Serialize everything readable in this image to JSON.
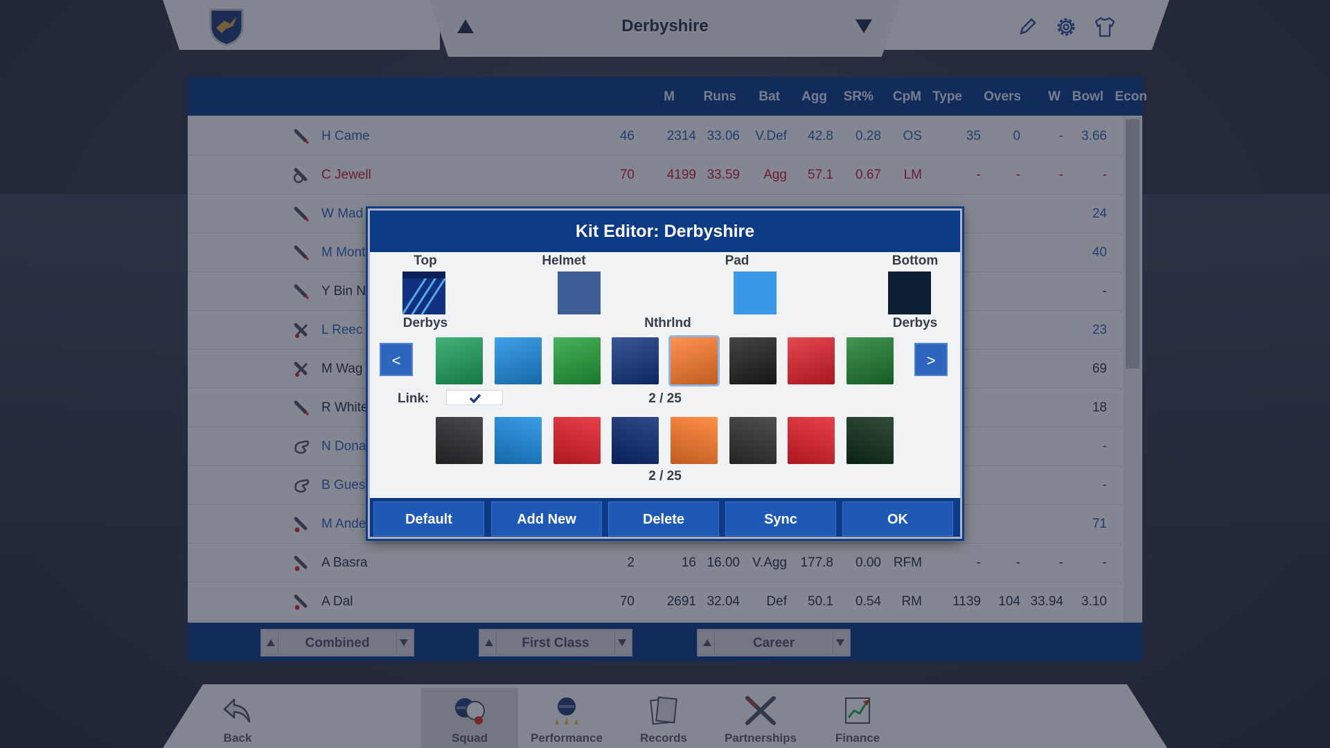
{
  "header": {
    "team": "Derbyshire"
  },
  "table": {
    "columns": [
      "M",
      "Runs",
      "Bat",
      "Agg",
      "SR%",
      "CpM",
      "Type",
      "Overs",
      "W",
      "Bowl",
      "Econ"
    ],
    "rows": [
      {
        "name": "H Came",
        "role": "batter",
        "color": "#2f5fb0",
        "cells": [
          "46",
          "2314",
          "33.06",
          "V.Def",
          "42.8",
          "0.28",
          "OS",
          "35",
          "0",
          "-",
          "3.66"
        ]
      },
      {
        "name": "C Jewell",
        "role": "keeper",
        "color": "#b4213a",
        "cells": [
          "70",
          "4199",
          "33.59",
          "Agg",
          "57.1",
          "0.67",
          "LM",
          "-",
          "-",
          "-",
          "-"
        ]
      },
      {
        "name": "W Mad",
        "role": "batter",
        "color": "#2f5fb0",
        "cells": [
          "",
          "",
          "",
          "",
          "",
          "",
          "",
          "",
          "",
          "",
          "24"
        ]
      },
      {
        "name": "M Mont",
        "role": "batter",
        "color": "#2f5fb0",
        "cells": [
          "",
          "",
          "",
          "",
          "",
          "",
          "",
          "",
          "",
          "",
          "40"
        ]
      },
      {
        "name": "Y Bin N",
        "role": "batter",
        "color": "#26344f",
        "cells": [
          "",
          "",
          "",
          "",
          "",
          "",
          "",
          "",
          "",
          "",
          "-"
        ]
      },
      {
        "name": "L Reec",
        "role": "allrounder",
        "color": "#2f5fb0",
        "cells": [
          "",
          "",
          "",
          "",
          "",
          "",
          "",
          "",
          "",
          "",
          "23"
        ]
      },
      {
        "name": "M Wag",
        "role": "allrounder",
        "color": "#26344f",
        "cells": [
          "",
          "",
          "",
          "",
          "",
          "",
          "",
          "",
          "",
          "",
          "69"
        ]
      },
      {
        "name": "R White",
        "role": "batter",
        "color": "#26344f",
        "cells": [
          "",
          "",
          "",
          "",
          "",
          "",
          "",
          "",
          "",
          "",
          "18"
        ]
      },
      {
        "name": "N Dona",
        "role": "keeper-glove",
        "color": "#2f5fb0",
        "cells": [
          "",
          "",
          "",
          "",
          "",
          "",
          "",
          "",
          "",
          "",
          "-"
        ]
      },
      {
        "name": "B Gues",
        "role": "keeper-glove",
        "color": "#2f5fb0",
        "cells": [
          "",
          "",
          "",
          "",
          "",
          "",
          "",
          "",
          "",
          "",
          "-"
        ]
      },
      {
        "name": "M Ande",
        "role": "bowler",
        "color": "#2f5fb0",
        "cells": [
          "",
          "",
          "",
          "",
          "",
          "",
          "",
          "",
          "",
          "",
          "71"
        ]
      },
      {
        "name": "A Basra",
        "role": "bowler",
        "color": "#26344f",
        "cells": [
          "2",
          "16",
          "16.00",
          "V.Agg",
          "177.8",
          "0.00",
          "RFM",
          "-",
          "-",
          "-",
          "-"
        ]
      },
      {
        "name": "A Dal",
        "role": "bowler",
        "color": "#26344f",
        "cells": [
          "70",
          "2691",
          "32.04",
          "Def",
          "50.1",
          "0.54",
          "RM",
          "1139",
          "104",
          "33.94",
          "3.10"
        ]
      }
    ]
  },
  "filters": [
    "Combined",
    "First Class",
    "Career"
  ],
  "modal": {
    "title": "Kit Editor: Derbyshire",
    "labels": {
      "top": "Top",
      "helmet": "Helmet",
      "pad": "Pad",
      "bottom": "Bottom",
      "top_name": "Derbys",
      "mid_name": "Nthrlnd",
      "bottom_name": "Derbys",
      "link": "Link:"
    },
    "counter_top": "2 / 25",
    "counter_bottom": "2 / 25",
    "prev_label": "<",
    "next_label": ">",
    "link_checked": true,
    "swatch_colors": {
      "helmet": "#3d5d96",
      "pad": "#3b98e8",
      "bottom": "#0d1f33"
    },
    "shirt_colors": [
      "#1aa05c",
      "#1a8be2",
      "#21a038",
      "#10327e",
      "#ff7b2a",
      "#1c1c1e",
      "#e01f2a",
      "#1c7b30"
    ],
    "trouser_colors": [
      "#2a2b2e",
      "#1a8be2",
      "#e61f2a",
      "#0b2a73",
      "#ff7b2a",
      "#2f3032",
      "#e61f2a",
      "#0e2d18"
    ],
    "selected_index": 4,
    "buttons": [
      "Default",
      "Add New",
      "Delete",
      "Sync",
      "OK"
    ]
  },
  "bottom_nav": [
    {
      "label": "Back",
      "icon": "back-arrow-icon"
    },
    {
      "label": "Squad",
      "icon": "squad-icon",
      "active": true
    },
    {
      "label": "Performance",
      "icon": "performance-icon"
    },
    {
      "label": "Records",
      "icon": "records-icon"
    },
    {
      "label": "Partnerships",
      "icon": "partnerships-icon"
    },
    {
      "label": "Finance",
      "icon": "finance-icon"
    }
  ]
}
